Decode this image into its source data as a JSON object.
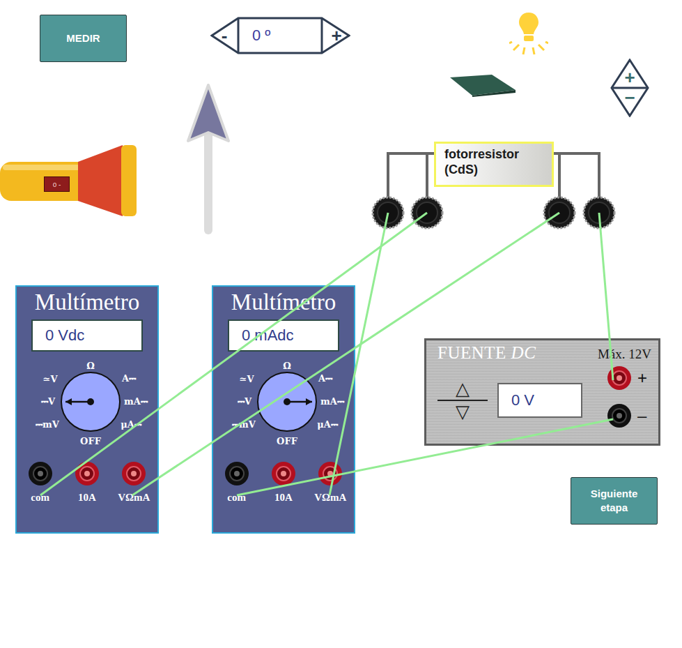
{
  "measure_button": "MEDIR",
  "angle_control": {
    "minus": "-",
    "value": "0 º",
    "plus": "+"
  },
  "flashlight": {
    "switch_label": "o -"
  },
  "lamp_control": {
    "plus": "+",
    "minus": "−"
  },
  "photoresistor": {
    "line1": "fotorresistor",
    "line2": "(CdS)"
  },
  "multimeters": [
    {
      "title": "Multímetro",
      "reading": "0 Vdc",
      "positions": [
        {
          "label": "Ω",
          "selected": false
        },
        {
          "label": "A⎓",
          "selected": false
        },
        {
          "label": "mA⎓",
          "selected": false
        },
        {
          "label": "μA⎓",
          "selected": false
        },
        {
          "label": "OFF",
          "selected": false
        },
        {
          "label": "⎓mV",
          "selected": false
        },
        {
          "label": "⎓V",
          "selected": true
        },
        {
          "label": "≃V",
          "selected": false
        }
      ],
      "jacks": [
        "com",
        "10A",
        "VΩmA"
      ]
    },
    {
      "title": "Multímetro",
      "reading": "0 mAdc",
      "positions": [
        {
          "label": "Ω",
          "selected": false
        },
        {
          "label": "A⎓",
          "selected": false
        },
        {
          "label": "mA⎓",
          "selected": true
        },
        {
          "label": "μA⎓",
          "selected": false
        },
        {
          "label": "OFF",
          "selected": false
        },
        {
          "label": "⎓mV",
          "selected": false
        },
        {
          "label": "⎓V",
          "selected": false
        },
        {
          "label": "≃V",
          "selected": false
        }
      ],
      "jacks": [
        "com",
        "10A",
        "VΩmA"
      ]
    }
  ],
  "power_supply": {
    "title": "FUENTE",
    "title_italic": "DC",
    "max": "Máx. 12V",
    "reading": "0 V",
    "up": "△",
    "down": "▽",
    "plus": "+",
    "minus": "–"
  },
  "wires": [
    {
      "from": "photo-2",
      "to": "mm1-VΩmA-x"
    },
    {
      "from": "photo-3",
      "to": "mm1-VΩmA"
    },
    {
      "from": "photo-1",
      "to": "mm2-VΩmA"
    },
    {
      "from": "photo-4",
      "to": "psu-plus"
    },
    {
      "from": "psu-minus",
      "to": "mm2-com"
    }
  ],
  "next_button": "Siguiente etapa"
}
